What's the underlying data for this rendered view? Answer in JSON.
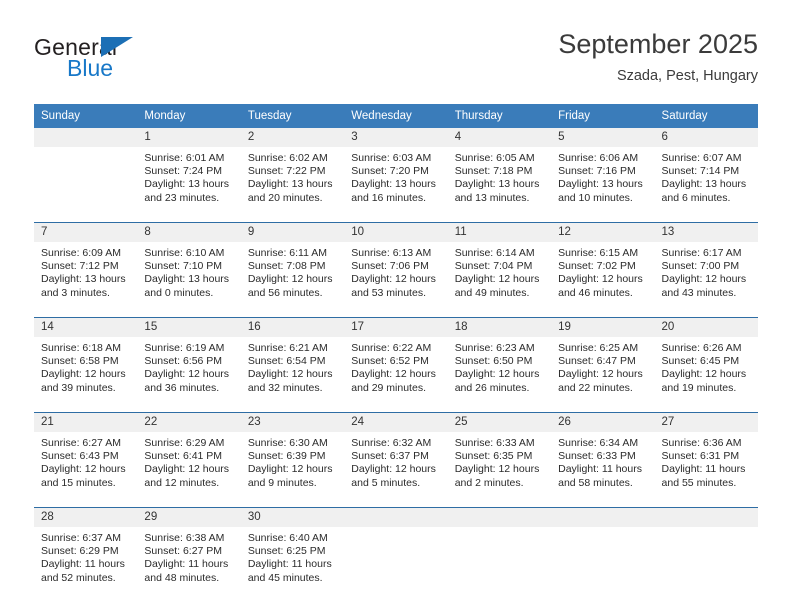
{
  "brand": {
    "name_part1": "General",
    "name_part2": "Blue",
    "triangle_color": "#1c6fb5",
    "blue_color": "#1878c8"
  },
  "header": {
    "month_title": "September 2025",
    "location": "Szada, Pest, Hungary"
  },
  "theme": {
    "header_row_bg": "#3a7cba",
    "week_divider": "#2e6da4",
    "daynum_bg": "#f0f0f0"
  },
  "weekday_headers": [
    "Sunday",
    "Monday",
    "Tuesday",
    "Wednesday",
    "Thursday",
    "Friday",
    "Saturday"
  ],
  "weeks": [
    [
      {
        "day": "",
        "sunrise": "",
        "sunset": "",
        "daylight_line1": "",
        "daylight_line2": ""
      },
      {
        "day": "1",
        "sunrise": "Sunrise: 6:01 AM",
        "sunset": "Sunset: 7:24 PM",
        "daylight_line1": "Daylight: 13 hours",
        "daylight_line2": "and 23 minutes."
      },
      {
        "day": "2",
        "sunrise": "Sunrise: 6:02 AM",
        "sunset": "Sunset: 7:22 PM",
        "daylight_line1": "Daylight: 13 hours",
        "daylight_line2": "and 20 minutes."
      },
      {
        "day": "3",
        "sunrise": "Sunrise: 6:03 AM",
        "sunset": "Sunset: 7:20 PM",
        "daylight_line1": "Daylight: 13 hours",
        "daylight_line2": "and 16 minutes."
      },
      {
        "day": "4",
        "sunrise": "Sunrise: 6:05 AM",
        "sunset": "Sunset: 7:18 PM",
        "daylight_line1": "Daylight: 13 hours",
        "daylight_line2": "and 13 minutes."
      },
      {
        "day": "5",
        "sunrise": "Sunrise: 6:06 AM",
        "sunset": "Sunset: 7:16 PM",
        "daylight_line1": "Daylight: 13 hours",
        "daylight_line2": "and 10 minutes."
      },
      {
        "day": "6",
        "sunrise": "Sunrise: 6:07 AM",
        "sunset": "Sunset: 7:14 PM",
        "daylight_line1": "Daylight: 13 hours",
        "daylight_line2": "and 6 minutes."
      }
    ],
    [
      {
        "day": "7",
        "sunrise": "Sunrise: 6:09 AM",
        "sunset": "Sunset: 7:12 PM",
        "daylight_line1": "Daylight: 13 hours",
        "daylight_line2": "and 3 minutes."
      },
      {
        "day": "8",
        "sunrise": "Sunrise: 6:10 AM",
        "sunset": "Sunset: 7:10 PM",
        "daylight_line1": "Daylight: 13 hours",
        "daylight_line2": "and 0 minutes."
      },
      {
        "day": "9",
        "sunrise": "Sunrise: 6:11 AM",
        "sunset": "Sunset: 7:08 PM",
        "daylight_line1": "Daylight: 12 hours",
        "daylight_line2": "and 56 minutes."
      },
      {
        "day": "10",
        "sunrise": "Sunrise: 6:13 AM",
        "sunset": "Sunset: 7:06 PM",
        "daylight_line1": "Daylight: 12 hours",
        "daylight_line2": "and 53 minutes."
      },
      {
        "day": "11",
        "sunrise": "Sunrise: 6:14 AM",
        "sunset": "Sunset: 7:04 PM",
        "daylight_line1": "Daylight: 12 hours",
        "daylight_line2": "and 49 minutes."
      },
      {
        "day": "12",
        "sunrise": "Sunrise: 6:15 AM",
        "sunset": "Sunset: 7:02 PM",
        "daylight_line1": "Daylight: 12 hours",
        "daylight_line2": "and 46 minutes."
      },
      {
        "day": "13",
        "sunrise": "Sunrise: 6:17 AM",
        "sunset": "Sunset: 7:00 PM",
        "daylight_line1": "Daylight: 12 hours",
        "daylight_line2": "and 43 minutes."
      }
    ],
    [
      {
        "day": "14",
        "sunrise": "Sunrise: 6:18 AM",
        "sunset": "Sunset: 6:58 PM",
        "daylight_line1": "Daylight: 12 hours",
        "daylight_line2": "and 39 minutes."
      },
      {
        "day": "15",
        "sunrise": "Sunrise: 6:19 AM",
        "sunset": "Sunset: 6:56 PM",
        "daylight_line1": "Daylight: 12 hours",
        "daylight_line2": "and 36 minutes."
      },
      {
        "day": "16",
        "sunrise": "Sunrise: 6:21 AM",
        "sunset": "Sunset: 6:54 PM",
        "daylight_line1": "Daylight: 12 hours",
        "daylight_line2": "and 32 minutes."
      },
      {
        "day": "17",
        "sunrise": "Sunrise: 6:22 AM",
        "sunset": "Sunset: 6:52 PM",
        "daylight_line1": "Daylight: 12 hours",
        "daylight_line2": "and 29 minutes."
      },
      {
        "day": "18",
        "sunrise": "Sunrise: 6:23 AM",
        "sunset": "Sunset: 6:50 PM",
        "daylight_line1": "Daylight: 12 hours",
        "daylight_line2": "and 26 minutes."
      },
      {
        "day": "19",
        "sunrise": "Sunrise: 6:25 AM",
        "sunset": "Sunset: 6:47 PM",
        "daylight_line1": "Daylight: 12 hours",
        "daylight_line2": "and 22 minutes."
      },
      {
        "day": "20",
        "sunrise": "Sunrise: 6:26 AM",
        "sunset": "Sunset: 6:45 PM",
        "daylight_line1": "Daylight: 12 hours",
        "daylight_line2": "and 19 minutes."
      }
    ],
    [
      {
        "day": "21",
        "sunrise": "Sunrise: 6:27 AM",
        "sunset": "Sunset: 6:43 PM",
        "daylight_line1": "Daylight: 12 hours",
        "daylight_line2": "and 15 minutes."
      },
      {
        "day": "22",
        "sunrise": "Sunrise: 6:29 AM",
        "sunset": "Sunset: 6:41 PM",
        "daylight_line1": "Daylight: 12 hours",
        "daylight_line2": "and 12 minutes."
      },
      {
        "day": "23",
        "sunrise": "Sunrise: 6:30 AM",
        "sunset": "Sunset: 6:39 PM",
        "daylight_line1": "Daylight: 12 hours",
        "daylight_line2": "and 9 minutes."
      },
      {
        "day": "24",
        "sunrise": "Sunrise: 6:32 AM",
        "sunset": "Sunset: 6:37 PM",
        "daylight_line1": "Daylight: 12 hours",
        "daylight_line2": "and 5 minutes."
      },
      {
        "day": "25",
        "sunrise": "Sunrise: 6:33 AM",
        "sunset": "Sunset: 6:35 PM",
        "daylight_line1": "Daylight: 12 hours",
        "daylight_line2": "and 2 minutes."
      },
      {
        "day": "26",
        "sunrise": "Sunrise: 6:34 AM",
        "sunset": "Sunset: 6:33 PM",
        "daylight_line1": "Daylight: 11 hours",
        "daylight_line2": "and 58 minutes."
      },
      {
        "day": "27",
        "sunrise": "Sunrise: 6:36 AM",
        "sunset": "Sunset: 6:31 PM",
        "daylight_line1": "Daylight: 11 hours",
        "daylight_line2": "and 55 minutes."
      }
    ],
    [
      {
        "day": "28",
        "sunrise": "Sunrise: 6:37 AM",
        "sunset": "Sunset: 6:29 PM",
        "daylight_line1": "Daylight: 11 hours",
        "daylight_line2": "and 52 minutes."
      },
      {
        "day": "29",
        "sunrise": "Sunrise: 6:38 AM",
        "sunset": "Sunset: 6:27 PM",
        "daylight_line1": "Daylight: 11 hours",
        "daylight_line2": "and 48 minutes."
      },
      {
        "day": "30",
        "sunrise": "Sunrise: 6:40 AM",
        "sunset": "Sunset: 6:25 PM",
        "daylight_line1": "Daylight: 11 hours",
        "daylight_line2": "and 45 minutes."
      },
      {
        "day": "",
        "sunrise": "",
        "sunset": "",
        "daylight_line1": "",
        "daylight_line2": ""
      },
      {
        "day": "",
        "sunrise": "",
        "sunset": "",
        "daylight_line1": "",
        "daylight_line2": ""
      },
      {
        "day": "",
        "sunrise": "",
        "sunset": "",
        "daylight_line1": "",
        "daylight_line2": ""
      },
      {
        "day": "",
        "sunrise": "",
        "sunset": "",
        "daylight_line1": "",
        "daylight_line2": ""
      }
    ]
  ]
}
